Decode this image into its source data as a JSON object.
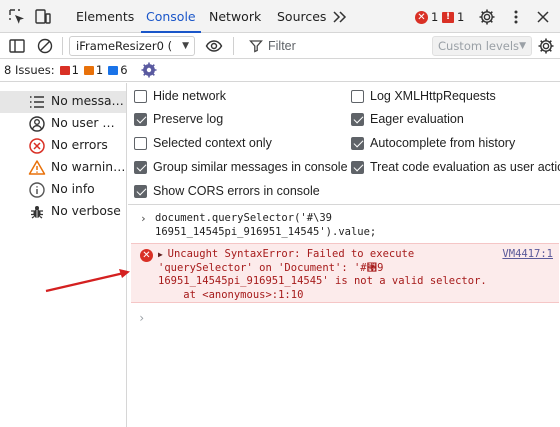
{
  "tabbar": {
    "tabs": [
      {
        "label": "Elements",
        "active": false
      },
      {
        "label": "Console",
        "active": true
      },
      {
        "label": "Network",
        "active": false
      },
      {
        "label": "Sources",
        "active": false
      }
    ],
    "more_tabs_icon": "double-chevron-right-icon",
    "error_count": "1",
    "issue_count": "1",
    "icons": [
      "inspect-element-icon",
      "device-toggle-icon",
      "settings-gear-icon",
      "more-vertical-icon",
      "close-icon"
    ]
  },
  "toolbar": {
    "context_select": "iFrameResizer0 (",
    "filter_placeholder": "Filter",
    "levels_label": "Custom levels",
    "icons": [
      "sidebar-toggle-icon",
      "clear-console-icon",
      "eye-icon",
      "filter-icon",
      "settings-gear-icon"
    ]
  },
  "issues": {
    "label": "8 Issues:",
    "errors": "1",
    "warnings": "1",
    "info": "6"
  },
  "sidebar": {
    "items": [
      {
        "label": "No messa…",
        "icon": "list-icon",
        "selected": true
      },
      {
        "label": "No user m…",
        "icon": "user-icon",
        "selected": false
      },
      {
        "label": "No errors",
        "icon": "error-circle-icon",
        "selected": false
      },
      {
        "label": "No warnings",
        "icon": "warning-triangle-icon",
        "selected": false
      },
      {
        "label": "No info",
        "icon": "info-circle-icon",
        "selected": false
      },
      {
        "label": "No verbose",
        "icon": "bug-icon",
        "selected": false
      }
    ]
  },
  "settings": {
    "left": [
      {
        "label": "Hide network",
        "checked": false
      },
      {
        "label": "Preserve log",
        "checked": true
      },
      {
        "label": "Selected context only",
        "checked": false
      },
      {
        "label": "Group similar messages in console",
        "checked": true
      },
      {
        "label": "Show CORS errors in console",
        "checked": true
      }
    ],
    "right": [
      {
        "label": "Log XMLHttpRequests",
        "checked": false
      },
      {
        "label": "Eager evaluation",
        "checked": true
      },
      {
        "label": "Autocomplete from history",
        "checked": true
      },
      {
        "label": "Treat code evaluation as user action",
        "checked": true
      }
    ]
  },
  "console": {
    "command_line1": "document.querySelector('#\\39",
    "command_line2": "16951_14545pi_916951_14545').value;",
    "error_line1": "Uncaught SyntaxError: Failed to execute",
    "error_line2": "'querySelector' on 'Document': '#⑙9",
    "error_line3": "16951_14545pi_916951_14545' is not a valid selector.",
    "error_line4": "    at <anonymous>:1:10",
    "error_source": "VM4417:1",
    "prompt_symbol": "›"
  },
  "colors": {
    "accent": "#1a56c9",
    "error": "#d93025",
    "error_bg": "#fcebeb",
    "annotation_arrow": "#d42020"
  }
}
